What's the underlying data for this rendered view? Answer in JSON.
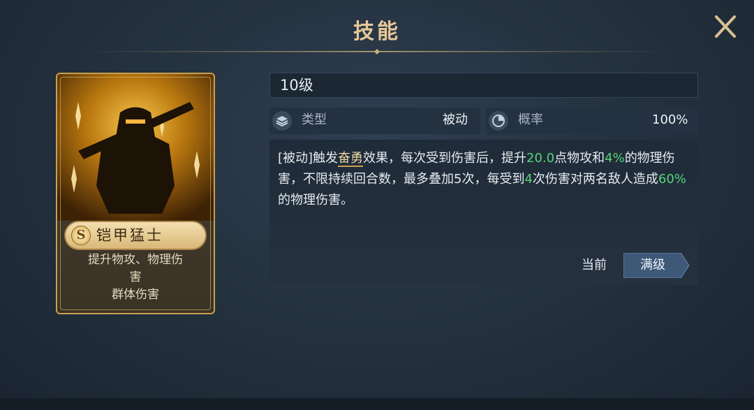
{
  "dialog": {
    "title": "技能",
    "close_icon": "close-icon"
  },
  "card": {
    "rank": "S",
    "name": "铠甲猛士",
    "desc_lines": [
      "提升物攻、物理伤",
      "害",
      "群体伤害"
    ],
    "art_icon": "armored-warrior-icon"
  },
  "level": "10级",
  "info": {
    "type_label": "类型",
    "type_value": "被动",
    "type_icon": "layers-icon",
    "chance_label": "概率",
    "chance_value": "100%",
    "chance_icon": "chance-dial-icon"
  },
  "description": {
    "segments": [
      {
        "text": "[被动]触发",
        "style": "normal"
      },
      {
        "text": "奋勇",
        "style": "underline"
      },
      {
        "text": "效果，每次受到伤害后，提升",
        "style": "normal"
      },
      {
        "text": "20.0",
        "style": "green"
      },
      {
        "text": "点物攻和",
        "style": "normal"
      },
      {
        "text": "4%",
        "style": "green"
      },
      {
        "text": "的物理伤害，不限持续回合数，最多叠加5次，每受到",
        "style": "normal"
      },
      {
        "text": "4",
        "style": "green"
      },
      {
        "text": "次伤害对两名敌人造成",
        "style": "normal"
      },
      {
        "text": "60%",
        "style": "green"
      },
      {
        "text": "的物理伤害。",
        "style": "normal"
      }
    ]
  },
  "buttons": {
    "current": "当前",
    "max_level": "满级"
  },
  "colors": {
    "accent_gold": "#c9a04f",
    "highlight_green": "#56d47a",
    "max_button": "#3e5878"
  }
}
